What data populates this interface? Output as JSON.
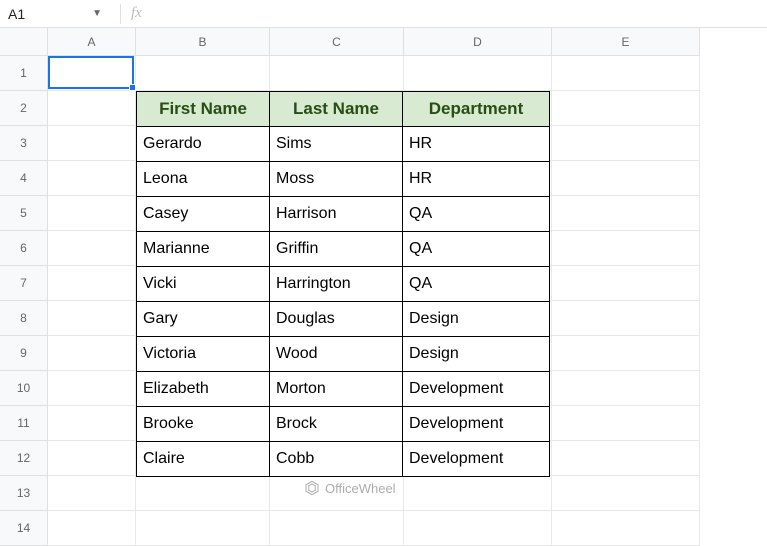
{
  "nameBox": "A1",
  "fxLabel": "fx",
  "columns": [
    "A",
    "B",
    "C",
    "D",
    "E"
  ],
  "rows": [
    "1",
    "2",
    "3",
    "4",
    "5",
    "6",
    "7",
    "8",
    "9",
    "10",
    "11",
    "12",
    "13",
    "14"
  ],
  "table": {
    "headers": [
      "First Name",
      "Last Name",
      "Department"
    ],
    "data": [
      [
        "Gerardo",
        "Sims",
        "HR"
      ],
      [
        "Leona",
        "Moss",
        "HR"
      ],
      [
        "Casey",
        "Harrison",
        "QA"
      ],
      [
        "Marianne",
        "Griffin",
        "QA"
      ],
      [
        "Vicki",
        "Harrington",
        "QA"
      ],
      [
        "Gary",
        "Douglas",
        "Design"
      ],
      [
        "Victoria",
        "Wood",
        "Design"
      ],
      [
        "Elizabeth",
        "Morton",
        "Development"
      ],
      [
        "Brooke",
        "Brock",
        "Development"
      ],
      [
        "Claire",
        "Cobb",
        "Development"
      ]
    ]
  },
  "watermark": "OfficeWheel"
}
